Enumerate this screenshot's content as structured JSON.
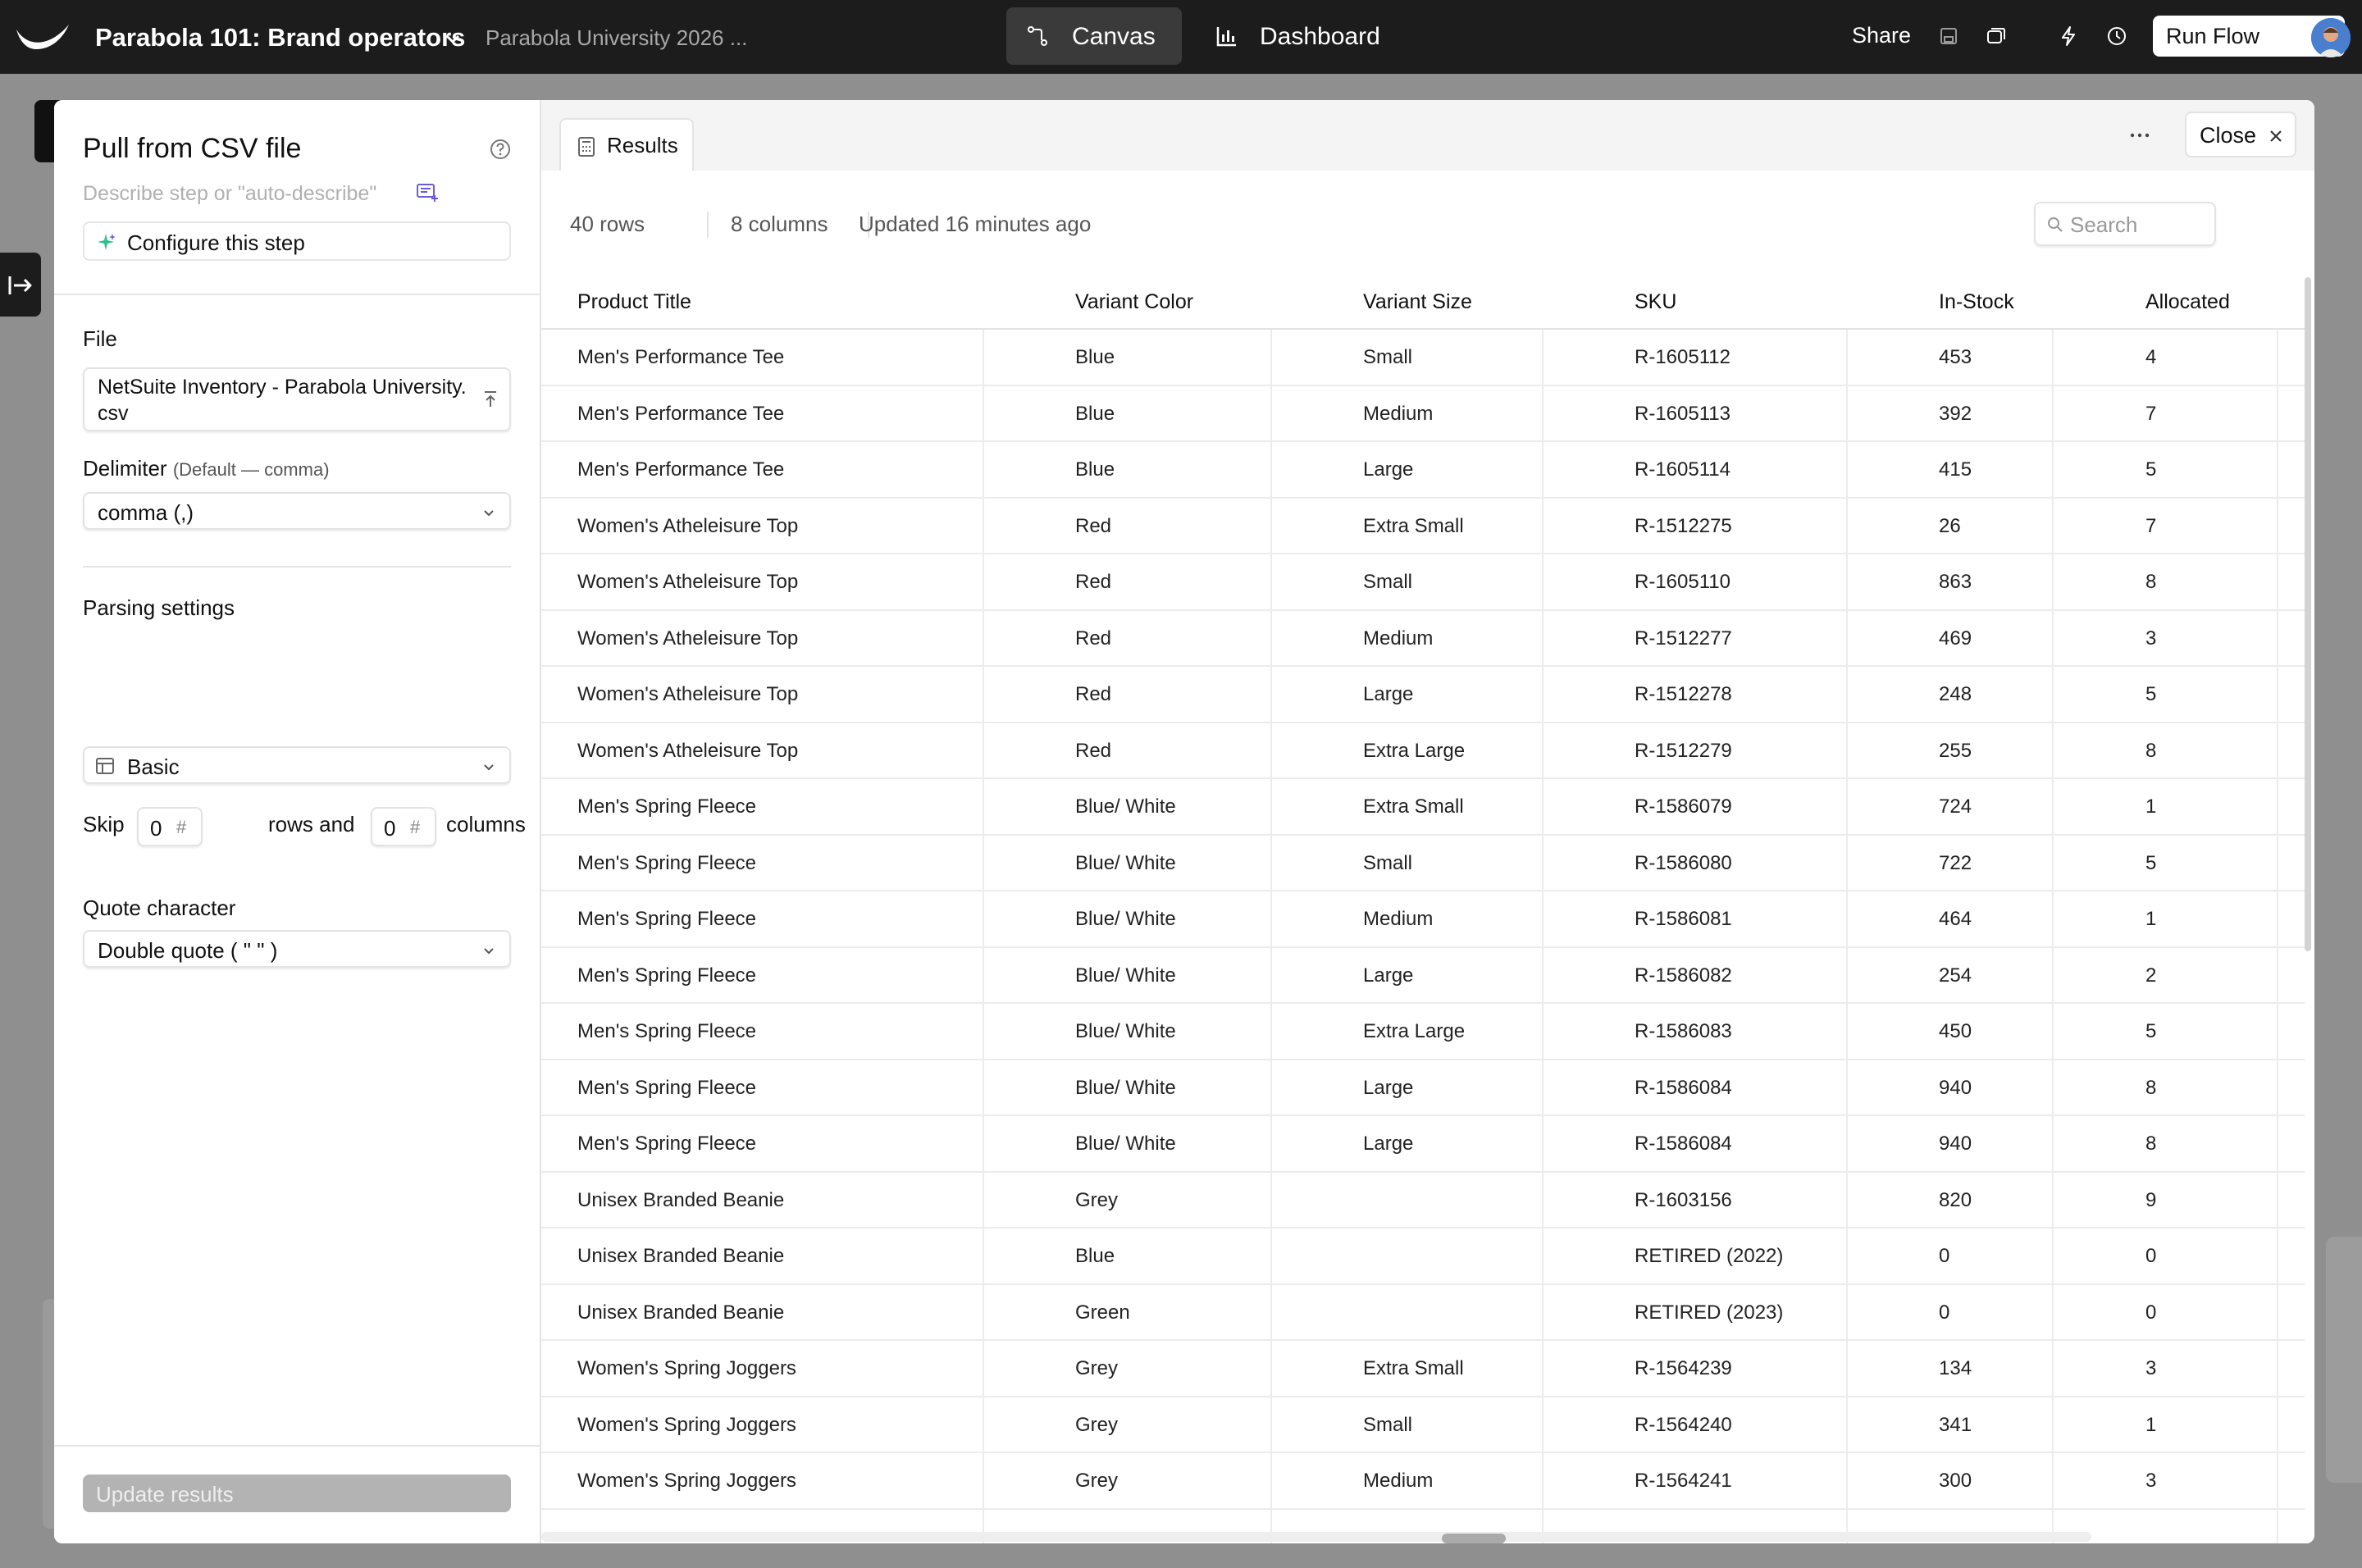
{
  "topbar": {
    "project_title": "Parabola 101: Brand operators",
    "project_subtitle": "Parabola University 2026 ...",
    "tabs": [
      {
        "label": "Canvas",
        "icon": "flow-icon",
        "active": true
      },
      {
        "label": "Dashboard",
        "icon": "bar-chart-icon",
        "active": false
      }
    ],
    "share_label": "Share",
    "icons": [
      "save-icon",
      "versions-icon",
      "bolt-icon",
      "history-icon"
    ],
    "run_flow_label": "Run Flow"
  },
  "step_panel": {
    "title": "Pull from CSV file",
    "describe_placeholder": "Describe step or \"auto-describe\"",
    "configure_label": "Configure this step",
    "file_label": "File",
    "file_name": "NetSuite Inventory - Parabola University.csv",
    "delimiter_label": "Delimiter",
    "delimiter_hint": "(Default — comma)",
    "delimiter_value": "comma (,)",
    "parsing_label": "Parsing settings",
    "parsing_value": "Basic",
    "skip_label": "Skip",
    "skip_rows": "0",
    "rows_and_label": "rows and",
    "skip_columns": "0",
    "columns_label": "columns",
    "hash_symbol": "#",
    "quote_label": "Quote character",
    "quote_value": "Double quote ( \" \" )",
    "update_button": "Update results"
  },
  "results": {
    "tab_label": "Results",
    "close_label": "Close",
    "rows_count": "40 rows",
    "columns_count": "8 columns",
    "updated": "Updated 16 minutes ago",
    "search_placeholder": "Search",
    "columns": [
      "Product Title",
      "Variant Color",
      "Variant Size",
      "SKU",
      "In-Stock",
      "Allocated"
    ],
    "rows": [
      [
        "Men's Performance Tee",
        "Blue",
        "Small",
        "R-1605112",
        "453",
        "4"
      ],
      [
        "Men's Performance Tee",
        "Blue",
        "Medium",
        "R-1605113",
        "392",
        "7"
      ],
      [
        "Men's Performance Tee",
        "Blue",
        "Large",
        "R-1605114",
        "415",
        "5"
      ],
      [
        "Women's Atheleisure Top",
        "Red",
        "Extra Small",
        "R-1512275",
        "26",
        "7"
      ],
      [
        "Women's Atheleisure Top",
        "Red",
        "Small",
        "R-1605110",
        "863",
        "8"
      ],
      [
        "Women's Atheleisure Top",
        "Red",
        "Medium",
        "R-1512277",
        "469",
        "3"
      ],
      [
        "Women's Atheleisure Top",
        "Red",
        "Large",
        "R-1512278",
        "248",
        "5"
      ],
      [
        "Women's Atheleisure Top",
        "Red",
        "Extra Large",
        "R-1512279",
        "255",
        "8"
      ],
      [
        "Men's Spring Fleece",
        "Blue/ White",
        "Extra Small",
        "R-1586079",
        "724",
        "1"
      ],
      [
        "Men's Spring Fleece",
        "Blue/ White",
        "Small",
        "R-1586080",
        "722",
        "5"
      ],
      [
        "Men's Spring Fleece",
        "Blue/ White",
        "Medium",
        "R-1586081",
        "464",
        "1"
      ],
      [
        "Men's Spring Fleece",
        "Blue/ White",
        "Large",
        "R-1586082",
        "254",
        "2"
      ],
      [
        "Men's Spring Fleece",
        "Blue/ White",
        "Extra Large",
        "R-1586083",
        "450",
        "5"
      ],
      [
        "Men's Spring Fleece",
        "Blue/ White",
        "Large",
        "R-1586084",
        "940",
        "8"
      ],
      [
        "Men's Spring Fleece",
        "Blue/ White",
        "Large",
        "R-1586084",
        "940",
        "8"
      ],
      [
        "Unisex Branded Beanie",
        "Grey",
        "",
        "R-1603156",
        "820",
        "9"
      ],
      [
        "Unisex Branded Beanie",
        "Blue",
        "",
        "RETIRED (2022)",
        "0",
        "0"
      ],
      [
        "Unisex Branded Beanie",
        "Green",
        "",
        "RETIRED (2023)",
        "0",
        "0"
      ],
      [
        "Women's Spring Joggers",
        "Grey",
        "Extra Small",
        "R-1564239",
        "134",
        "3"
      ],
      [
        "Women's Spring Joggers",
        "Grey",
        "Small",
        "R-1564240",
        "341",
        "1"
      ],
      [
        "Women's Spring Joggers",
        "Grey",
        "Medium",
        "R-1564241",
        "300",
        "3"
      ]
    ]
  },
  "colors": {
    "topbar_bg": "#1c1c1c",
    "canvas_bg": "#8f8f8f",
    "accent_green": "#2fbf8f",
    "accent_purple": "#6b5bd6",
    "avatar": "#3b6fc4"
  }
}
